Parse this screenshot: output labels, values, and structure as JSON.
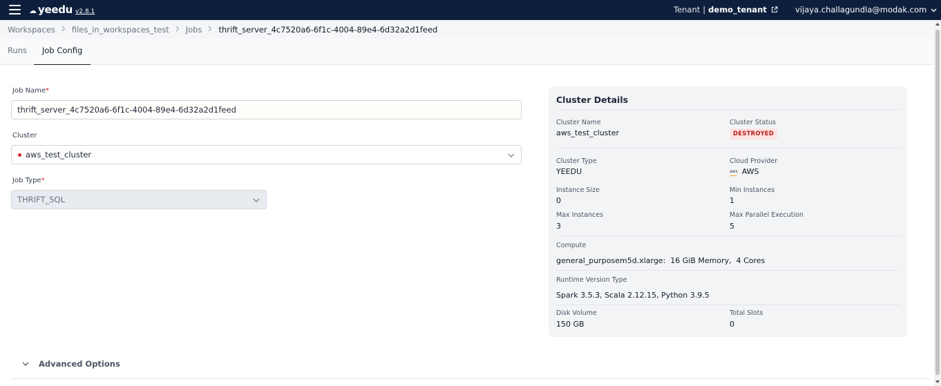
{
  "header": {
    "logo_text": "yeedu",
    "version": "v2.8.1",
    "tenant_label": "Tenant",
    "tenant_separator": "|",
    "tenant_name": "demo_tenant",
    "user_email": "vijaya.challagundla@modak.com"
  },
  "breadcrumb": {
    "items": [
      "Workspaces",
      "files_in_workspaces_test",
      "Jobs",
      "thrift_server_4c7520a6-6f1c-4004-89e4-6d32a2d1feed"
    ],
    "separator": ">"
  },
  "tabs": [
    {
      "label": "Runs",
      "active": false
    },
    {
      "label": "Job Config",
      "active": true
    }
  ],
  "form": {
    "job_name_label": "Job Name",
    "job_name_value": "thrift_server_4c7520a6-6f1c-4004-89e4-6d32a2d1feed",
    "required_marker": "*",
    "cluster_label": "Cluster",
    "cluster_value": "aws_test_cluster",
    "job_type_label": "Job Type",
    "job_type_value": "THRIFT_SQL"
  },
  "cluster_details": {
    "title": "Cluster Details",
    "cluster_name_label": "Cluster Name",
    "cluster_name_value": "aws_test_cluster",
    "cluster_status_label": "Cluster Status",
    "cluster_status_value": "DESTROYED",
    "cluster_type_label": "Cluster Type",
    "cluster_type_value": "YEEDU",
    "cloud_provider_label": "Cloud Provider",
    "cloud_provider_logo": "aws",
    "cloud_provider_value": "AWS",
    "instance_size_label": "Instance Size",
    "instance_size_value": "0",
    "min_instances_label": "Min Instances",
    "min_instances_value": "1",
    "max_instances_label": "Max Instances",
    "max_instances_value": "3",
    "max_parallel_label": "Max Parallel Execution",
    "max_parallel_value": "5",
    "compute_label": "Compute",
    "compute_value": "general_purposem5d.xlarge:  16 GiB Memory,  4 Cores",
    "runtime_label": "Runtime Version Type",
    "runtime_value": "Spark 3.5.3, Scala 2.12.15, Python 3.9.5",
    "disk_volume_label": "Disk Volume",
    "disk_volume_value": "150 GB",
    "total_slots_label": "Total Slots",
    "total_slots_value": "0"
  },
  "advanced": {
    "label": "Advanced Options"
  },
  "colors": {
    "topbar_bg": "#0d1f3c",
    "status_destroyed": "#b91c1c",
    "required": "#dc2626"
  },
  "icons": {
    "menu": "hamburger-icon",
    "external_link": "external-link-icon",
    "user_menu": "chevron-down-icon",
    "breadcrumb_sep": "chevron-right-icon",
    "select": "chevron-down-icon",
    "advanced_toggle": "chevron-down-icon"
  }
}
